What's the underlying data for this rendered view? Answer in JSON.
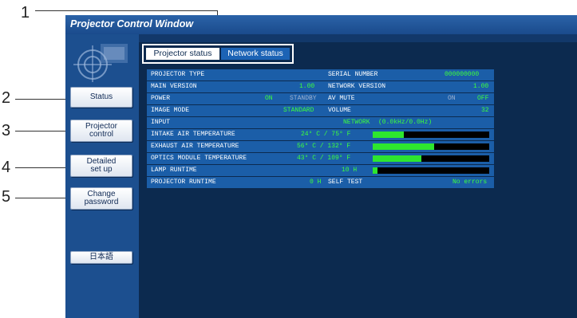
{
  "callouts": [
    "1",
    "2",
    "3",
    "4",
    "5"
  ],
  "window": {
    "title": "Projector Control Window"
  },
  "sidebar": {
    "buttons": [
      {
        "label": "Status"
      },
      {
        "label": "Projector\ncontrol"
      },
      {
        "label": "Detailed\nset up"
      },
      {
        "label": "Change\npassword"
      },
      {
        "label": "日本語"
      }
    ]
  },
  "tabs": [
    "Projector status",
    "Network status"
  ],
  "status": {
    "projector_type_label": "PROJECTOR TYPE",
    "serial_label": "SERIAL NUMBER",
    "serial_value": "000000000",
    "main_version_label": "MAIN VERSION",
    "main_version_value": "1.00",
    "network_version_label": "NETWORK VERSION",
    "network_version_value": "1.00",
    "power_label": "POWER",
    "power_on": "ON",
    "power_standby": "STANDBY",
    "av_mute_label": "AV MUTE",
    "av_mute_on": "ON",
    "av_mute_off": "OFF",
    "image_mode_label": "IMAGE MODE",
    "image_mode_value": "STANDARD",
    "volume_label": "VOLUME",
    "volume_value": "32",
    "input_label": "INPUT",
    "input_value": "NETWORK",
    "input_freq": "(0.0kHz/0.0Hz)",
    "intake_label": "INTAKE AIR TEMPERATURE",
    "intake_value": "24° C / 75° F",
    "intake_level": 0.27,
    "exhaust_label": "EXHAUST AIR TEMPERATURE",
    "exhaust_value": "56° C / 132° F",
    "exhaust_level": 0.53,
    "optics_label": "OPTICS MODULE TEMPERATURE",
    "optics_value": "43° C / 109° F",
    "optics_level": 0.42,
    "lamp_label": "LAMP RUNTIME",
    "lamp_value": "10 H",
    "lamp_level": 0.04,
    "projector_runtime_label": "PROJECTOR RUNTIME",
    "projector_runtime_value": "0 H",
    "self_test_label": "SELF TEST",
    "self_test_value": "No errors"
  },
  "colors": {
    "window_bg": "#0c2a4f",
    "row_bg": "#1b5ea8",
    "value_green": "#3dff3d",
    "bar_fill": "#2ee62e",
    "bar_bg": "#000000"
  }
}
